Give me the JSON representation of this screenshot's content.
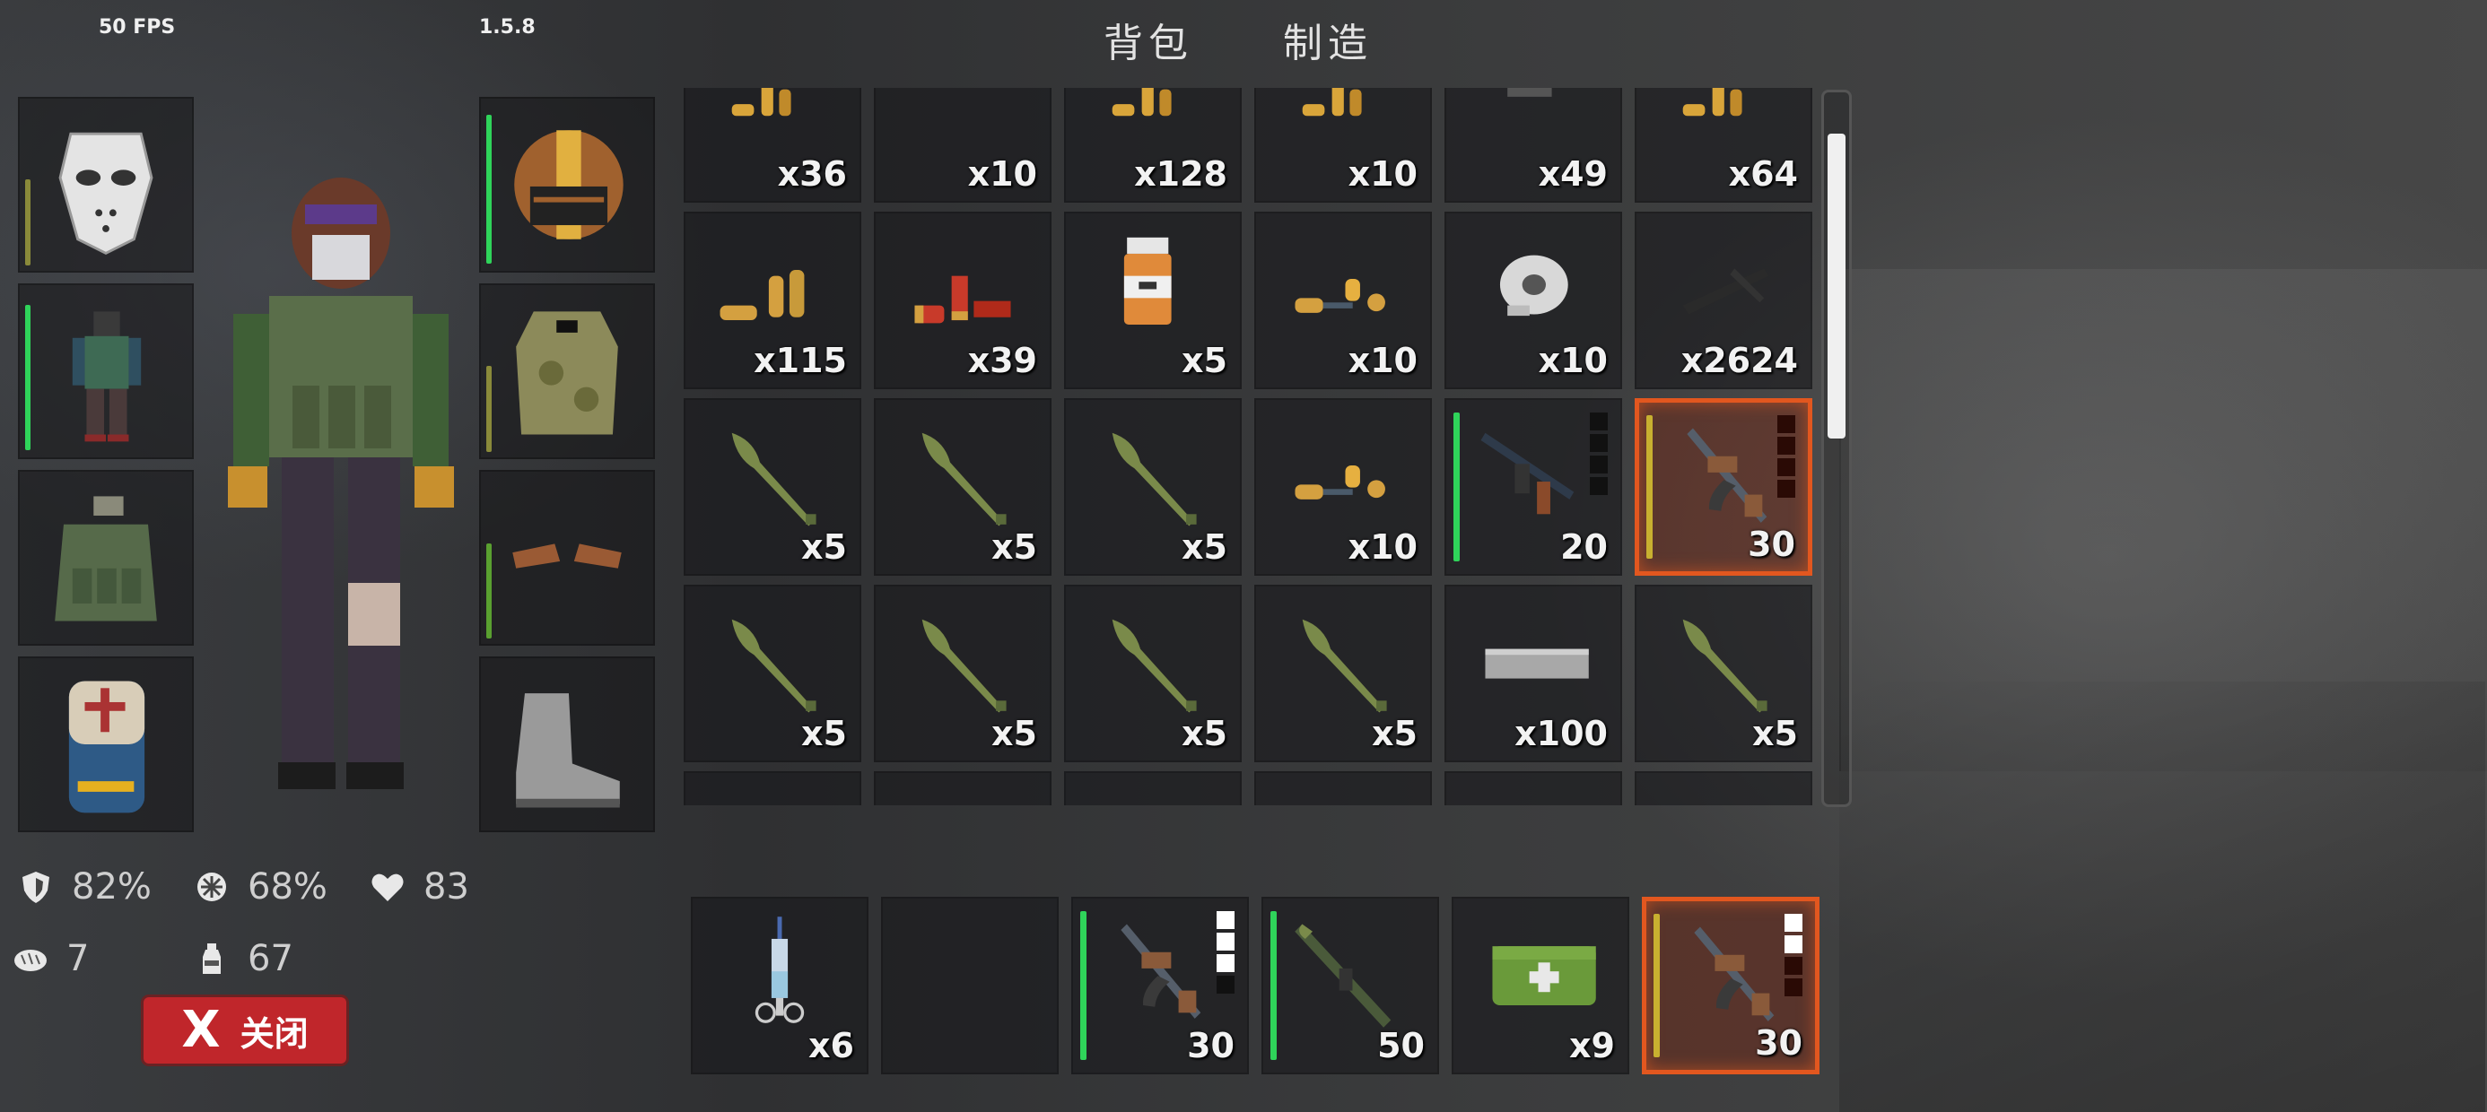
{
  "hud": {
    "fps": "50 FPS",
    "version": "1.5.8"
  },
  "tabs": [
    {
      "label": "背包"
    },
    {
      "label": "制造"
    }
  ],
  "equipment_left": [
    {
      "icon": "hockey-mask-icon",
      "bar_color": "#8a8a3a",
      "bar_level": 0.45
    },
    {
      "icon": "outfit-icon",
      "bar_color": "#2fd45a",
      "bar_level": 0.9
    },
    {
      "icon": "tactical-vest-icon"
    },
    {
      "icon": "backpack-icon"
    }
  ],
  "equipment_right": [
    {
      "icon": "football-helmet-icon",
      "bar_color": "#2fd45a",
      "bar_level": 0.95
    },
    {
      "icon": "body-armor-icon",
      "bar_color": "#8a8a3a",
      "bar_level": 0.5
    },
    {
      "icon": "gloves-icon",
      "bar_color": "#5aa030",
      "bar_level": 0.55
    },
    {
      "icon": "boots-icon"
    }
  ],
  "inventory": [
    {
      "icon": "ammo-icon",
      "count": "x36"
    },
    {
      "icon": "grenade-icon",
      "count": "x10"
    },
    {
      "icon": "ammo-icon",
      "count": "x128"
    },
    {
      "icon": "ammo-icon",
      "count": "x10"
    },
    {
      "icon": "item-icon",
      "count": "x49"
    },
    {
      "icon": "ammo-icon",
      "count": "x64"
    },
    {
      "icon": "pistol-ammo-icon",
      "count": "x115"
    },
    {
      "icon": "shotgun-shells-icon",
      "count": "x39"
    },
    {
      "icon": "pill-bottle-icon",
      "count": "x5"
    },
    {
      "icon": "rifle-ammo-icon",
      "count": "x10"
    },
    {
      "icon": "duct-tape-icon",
      "count": "x10"
    },
    {
      "icon": "crossbow-bolt-icon",
      "count": "x2624"
    },
    {
      "icon": "rpg-rocket-icon",
      "count": "x5"
    },
    {
      "icon": "rpg-rocket-icon",
      "count": "x5"
    },
    {
      "icon": "rpg-rocket-icon",
      "count": "x5"
    },
    {
      "icon": "rifle-ammo-icon",
      "count": "x10"
    },
    {
      "icon": "assault-rifle-icon",
      "count": "20",
      "bar_color": "#2fd45a",
      "ammo_pips": [
        "#111",
        "#111",
        "#111",
        "#111"
      ]
    },
    {
      "icon": "ak-rifle-icon",
      "count": "30",
      "selected": true,
      "bar_color": "#c8b030",
      "ammo_pips": [
        "#2a0a05",
        "#2a0a05",
        "#2a0a05",
        "#2a0a05"
      ]
    },
    {
      "icon": "rpg-rocket-icon",
      "count": "x5"
    },
    {
      "icon": "rpg-rocket-icon",
      "count": "x5"
    },
    {
      "icon": "rpg-rocket-icon",
      "count": "x5"
    },
    {
      "icon": "rpg-rocket-icon",
      "count": "x5"
    },
    {
      "icon": "metal-ingot-icon",
      "count": "x100"
    },
    {
      "icon": "rpg-rocket-icon",
      "count": "x5"
    },
    {
      "icon": "wire-icon",
      "count": ""
    },
    {
      "icon": "bag-icon",
      "count": ""
    },
    {
      "icon": "ammo-icon",
      "count": ""
    },
    {
      "icon": "dynamite-icon",
      "count": ""
    },
    {
      "icon": "dynamite-bundle-icon",
      "count": ""
    },
    {
      "icon": "dynamite-bundle-icon",
      "count": ""
    }
  ],
  "hotbar": [
    {
      "icon": "syringe-icon",
      "count": "x6"
    },
    {
      "icon": "empty-slot",
      "count": ""
    },
    {
      "icon": "ak-rifle-icon",
      "count": "30",
      "bar_color": "#2fd45a",
      "ammo_pips": [
        "#fff",
        "#fff",
        "#fff",
        "#111"
      ]
    },
    {
      "icon": "rpg-launcher-icon",
      "count": "50",
      "bar_color": "#2fd45a"
    },
    {
      "icon": "medkit-icon",
      "count": "x9"
    },
    {
      "icon": "ak-rifle-icon",
      "count": "30",
      "selected": true,
      "bar_color": "#c8b030",
      "ammo_pips": [
        "#fff",
        "#fff",
        "#2a0a05",
        "#2a0a05"
      ]
    }
  ],
  "stats": {
    "armor": "82%",
    "cold": "68%",
    "health": "83",
    "food": "7",
    "water": "67"
  },
  "close_button": {
    "label": "关闭",
    "x": "X"
  }
}
